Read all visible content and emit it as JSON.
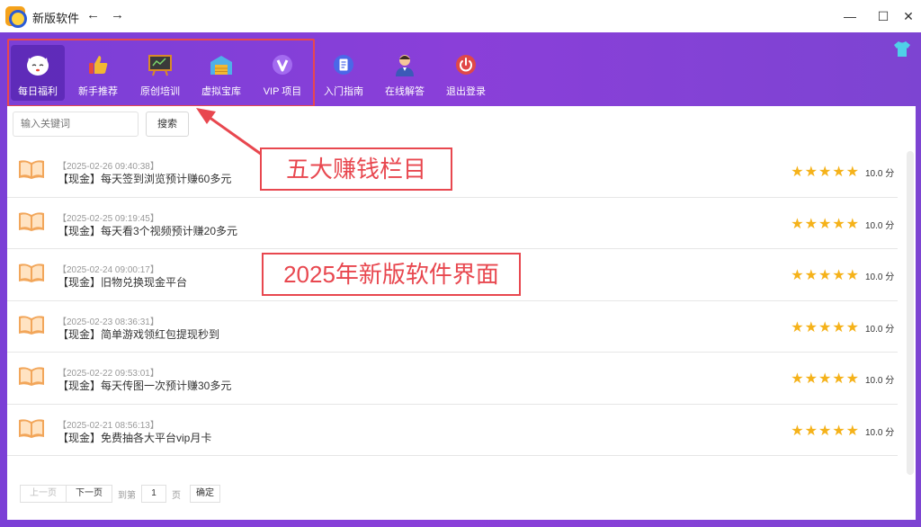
{
  "window": {
    "title": "新版软件",
    "back_icon": "←",
    "forward_icon": "→",
    "minimize_icon": "—",
    "maximize_icon": "☐",
    "close_icon": "✕"
  },
  "toolbar": {
    "items": [
      {
        "label": "每日福利",
        "icon": "lucky-cat-icon",
        "color": "#ffffff"
      },
      {
        "label": "新手推荐",
        "icon": "thumbs-up-icon",
        "color": "#e84b3c"
      },
      {
        "label": "原创培训",
        "icon": "blackboard-icon",
        "color": "#d88a2a"
      },
      {
        "label": "虚拟宝库",
        "icon": "warehouse-icon",
        "color": "#f2b832"
      },
      {
        "label": "VIP 项目",
        "icon": "vip-icon",
        "color": "#a36bf0"
      },
      {
        "label": "入门指南",
        "icon": "document-icon",
        "color": "#4b67e8"
      },
      {
        "label": "在线解答",
        "icon": "support-agent-icon",
        "color": "#f0a050"
      },
      {
        "label": "退出登录",
        "icon": "power-icon",
        "color": "#e04848"
      }
    ]
  },
  "search": {
    "placeholder": "输入关键词",
    "button_label": "搜索"
  },
  "list": {
    "items": [
      {
        "date": "【2025-02-26 09:40:38】",
        "title": "【现金】每天签到浏览预计赚60多元",
        "stars": "★★★★★",
        "score": "10.0 分"
      },
      {
        "date": "【2025-02-25 09:19:45】",
        "title": "【现金】每天看3个视频预计赚20多元",
        "stars": "★★★★★",
        "score": "10.0 分"
      },
      {
        "date": "【2025-02-24 09:00:17】",
        "title": "【现金】旧物兑换现金平台",
        "stars": "★★★★★",
        "score": "10.0 分"
      },
      {
        "date": "【2025-02-23 08:36:31】",
        "title": "【现金】简单游戏领红包提现秒到",
        "stars": "★★★★★",
        "score": "10.0 分"
      },
      {
        "date": "【2025-02-22 09:53:01】",
        "title": "【现金】每天传图一次预计赚30多元",
        "stars": "★★★★★",
        "score": "10.0 分"
      },
      {
        "date": "【2025-02-21 08:56:13】",
        "title": "【现金】免费抽各大平台vip月卡",
        "stars": "★★★★★",
        "score": "10.0 分"
      }
    ]
  },
  "pager": {
    "prev": "上一页",
    "next": "下一页",
    "goto": "到第",
    "page": "1",
    "unit": "页",
    "ok": "确定"
  },
  "annotations": {
    "five_columns": "五大赚钱栏目",
    "new_interface": "2025年新版软件界面"
  },
  "colors": {
    "accent": "#8a3fd9",
    "annotation": "#e8474f",
    "star": "#f5b21a"
  }
}
